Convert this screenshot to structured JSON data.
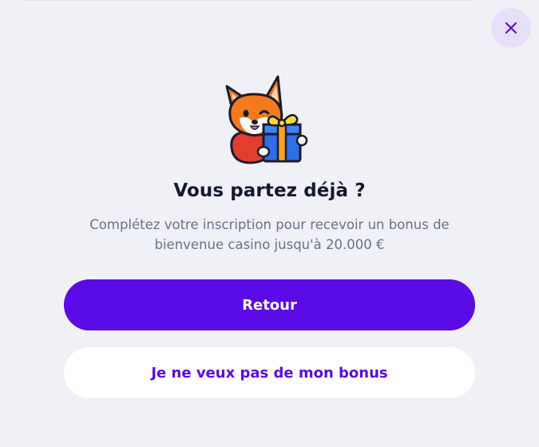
{
  "modal": {
    "title": "Vous partez déjà ?",
    "subtitle_line1": "Complétez votre inscription pour recevoir un bonus de",
    "subtitle_line2": "bienvenue casino jusqu'à 20.000 €",
    "primary_button_label": "Retour",
    "secondary_button_label": "Je ne veux pas de mon bonus",
    "close_icon": "close-icon",
    "mascot_icon": "fox-with-gift-icon"
  },
  "colors": {
    "background": "#f0f1f7",
    "accent": "#5b0be5",
    "close_button_bg": "#e7dff9",
    "title": "#16172b",
    "subtitle": "#6c6f83"
  }
}
